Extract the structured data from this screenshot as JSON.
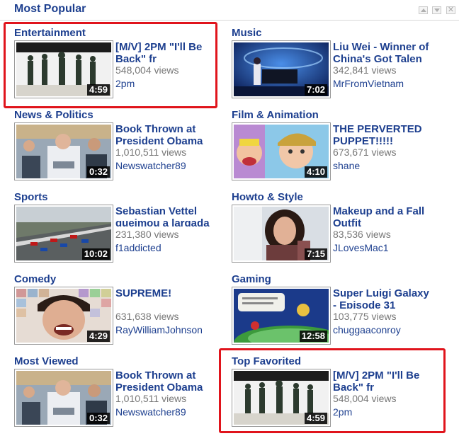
{
  "module": {
    "title": "Most Popular"
  },
  "categories": [
    {
      "name": "Entertainment",
      "video": {
        "title": "[M/V] 2PM \"I'll Be Back\" fr",
        "views": "548,004 views",
        "author": "2pm",
        "duration": "4:59"
      }
    },
    {
      "name": "Music",
      "video": {
        "title": "Liu Wei - Winner of China's Got Talen",
        "views": "342,841 views",
        "author": "MrFromVietnam",
        "duration": "7:02"
      }
    },
    {
      "name": "News & Politics",
      "video": {
        "title": "Book Thrown at President Obama",
        "views": "1,010,511 views",
        "author": "Newswatcher89",
        "duration": "0:32"
      }
    },
    {
      "name": "Film & Animation",
      "video": {
        "title": "THE PERVERTED PUPPET!!!!!",
        "views": "673,671 views",
        "author": "shane",
        "duration": "4:10"
      }
    },
    {
      "name": "Sports",
      "video": {
        "title": "Sebastian Vettel queimou a largada",
        "views": "231,380 views",
        "author": "f1addicted",
        "duration": "10:02"
      }
    },
    {
      "name": "Howto & Style",
      "video": {
        "title": "Makeup and a Fall Outfit",
        "views": "83,536 views",
        "author": "JLovesMac1",
        "duration": "7:15"
      }
    },
    {
      "name": "Comedy",
      "video": {
        "title": "SUPREME!",
        "views": "631,638 views",
        "author": "RayWilliamJohnson",
        "duration": "4:29"
      }
    },
    {
      "name": "Gaming",
      "video": {
        "title": "Super Luigi Galaxy - Episode 31",
        "views": "103,775 views",
        "author": "chuggaaconroy",
        "duration": "12:58"
      }
    },
    {
      "name": "Most Viewed",
      "video": {
        "title": "Book Thrown at President Obama",
        "views": "1,010,511 views",
        "author": "Newswatcher89",
        "duration": "0:32"
      }
    },
    {
      "name": "Top Favorited",
      "video": {
        "title": "[M/V] 2PM \"I'll Be Back\" fr",
        "views": "548,004 views",
        "author": "2pm",
        "duration": "4:59"
      }
    }
  ],
  "colors": {
    "link": "#1d3f8f",
    "meta": "#777777",
    "highlight": "#e0141c"
  }
}
